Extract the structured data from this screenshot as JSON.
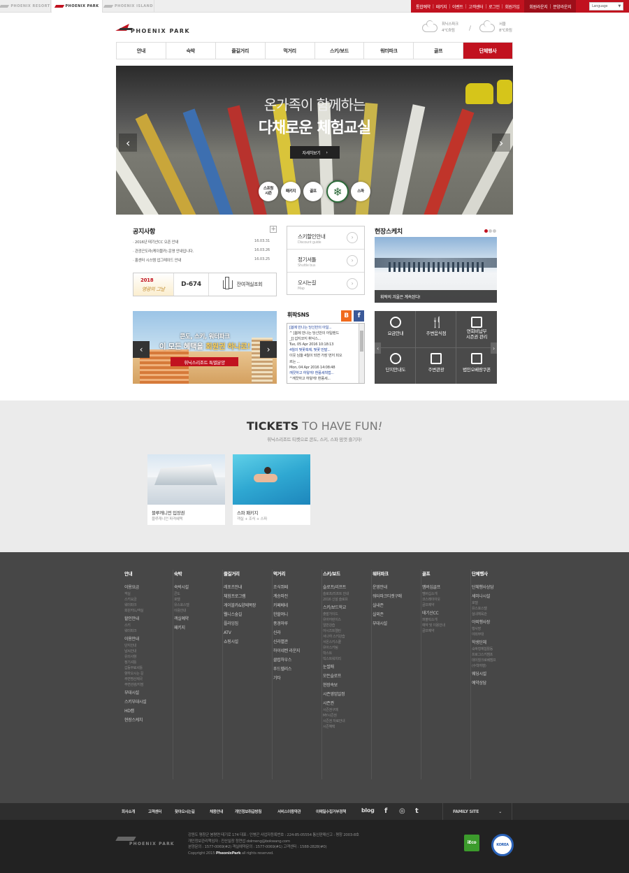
{
  "site_tabs": [
    {
      "label": "PHOENIX RESORT"
    },
    {
      "label": "PHOENIX PARK"
    },
    {
      "label": "PHOENIX ISLAND"
    }
  ],
  "util_links": [
    "통합예약",
    "패키지",
    "이벤트",
    "고객센터",
    "로그인",
    "회원가입"
  ],
  "util_links_dark": [
    "회원라운지",
    "분양라운지"
  ],
  "language": {
    "label": "Language",
    "options_hint": "▼"
  },
  "logo": {
    "text": "PHOENIX PARK"
  },
  "weather": [
    {
      "place": "휘닉스파크",
      "temp": "4℃흐림"
    },
    {
      "place": "서울",
      "temp": "8℃흐림"
    }
  ],
  "weather_sep": "/",
  "gnb": [
    "안내",
    "숙박",
    "즐길거리",
    "먹거리",
    "스키/보드",
    "워터파크",
    "골프",
    "단체행사"
  ],
  "hero": {
    "line1": "온가족이 함께하는",
    "line2": "다채로운 체험교실",
    "button": "자세히보기",
    "button_arrow": "›",
    "prev": "‹",
    "next": "›",
    "circles": [
      "스프링\n시즌",
      "패키지",
      "골프",
      "",
      "스파"
    ],
    "colors": {
      "red": "#c1121f"
    }
  },
  "notice": {
    "title": "공지사항",
    "plus": "+",
    "items": [
      {
        "text": "· 2016년 태기산CC 오픈 안내",
        "date": "16.03.31"
      },
      {
        "text": "· 관광곤도라(케이블카) 운영 안내입니다.",
        "date": "16.03.26"
      },
      {
        "text": "· 홀센터 시스템 업그레이드 안내",
        "date": "16.03.25"
      }
    ]
  },
  "dday": {
    "year": "2018",
    "name": "영광의 그날",
    "count": "D-674",
    "rooms": "잔여객실조회"
  },
  "quick": [
    {
      "title": "스키할인안내",
      "sub": "Discount guide"
    },
    {
      "title": "정기셔틀",
      "sub": "Shuttle bus"
    },
    {
      "title": "오시는길",
      "sub": "Map"
    }
  ],
  "quick_arrow": "›",
  "sketch": {
    "title": "현장스케치",
    "caption": "휘팍의 겨울은 계속된다!"
  },
  "banner": {
    "line1": "콘도, 스키, 워터파크",
    "line2a": "이 모든 혜택을 ",
    "line2b": "회원권 하나로!",
    "tag": "휘닉스리조트 특별분양",
    "prev": "‹",
    "next": "›"
  },
  "sns": {
    "title": "휘팍SNS",
    "blog": "B",
    "facebook": "f",
    "lines": [
      {
        "t": "[봄에 만나는 당신만의 아일...",
        "blue": true
      },
      {
        "t": "^ [봄에 만나는 당신만의 아일랜드",
        "blue": false
      },
      {
        "t": "_]] 섭지코지 휘닉스...",
        "blue": false
      },
      {
        "t": "Tue, 05 Apr 2016 10:18:13",
        "blue": false
      },
      {
        "t": "4월의 벚꽃축제, 벚꽃 만발...",
        "blue": true
      },
      {
        "t": "이웃 님들 4월이 되면 가장 먼저 피오",
        "blue": false
      },
      {
        "t": "르는 ...",
        "blue": false
      },
      {
        "t": "Mon, 04 Apr 2016 14:08:48",
        "blue": false
      },
      {
        "t": "깨끗하고 하얗게! 환풍세척법...",
        "blue": true
      },
      {
        "t": "^깨끗하고 하얗게! 환풍세...",
        "blue": false
      }
    ]
  },
  "dgrid": {
    "items": [
      {
        "label": "요금안내"
      },
      {
        "label": "주변음식점"
      },
      {
        "label": "연회비납부\n시즌권 관리"
      },
      {
        "label": "단지안내도"
      },
      {
        "label": "주변관광"
      },
      {
        "label": "법인오베랑쿠폰"
      }
    ],
    "prev": "‹",
    "next": "›"
  },
  "tickets": {
    "title_bold": "TICKETS",
    "title_rest": " TO HAVE FUN",
    "bang": "!",
    "sub": "휘닉스리조트 티켓으로 콘도, 스키, 스파 맘껏 즐기자!",
    "cards": [
      {
        "title": "블루캐니언 입장권",
        "sub": "블루캐니언 파격혜택"
      },
      {
        "title": "스파 패키지",
        "sub": "객실 + 조식 + 스파"
      }
    ]
  },
  "sitemap": [
    {
      "h": "안내",
      "items": [
        {
          "t": "이용요금",
          "subs": [
            "객실",
            "스키요금",
            "워터파크",
            "회원카드/객실"
          ]
        },
        {
          "t": "할인안내",
          "subs": [
            "스키",
            "워터파크"
          ]
        },
        {
          "t": "이용안내",
          "subs": [
            "단지안내",
            "날씨안내",
            "유의사항",
            "정기셔틀",
            "갑동무료셔틀",
            "항하오시는 길",
            "주변명산제국",
            "주변관광/지점"
          ]
        },
        {
          "t": "부대시설",
          "subs": []
        },
        {
          "t": "스키부대시설",
          "subs": []
        },
        {
          "t": "HD캠",
          "subs": []
        },
        {
          "t": "현장스케치",
          "subs": []
        }
      ]
    },
    {
      "h": "숙박",
      "items": [
        {
          "t": "숙박시설",
          "subs": [
            "콘도",
            "호텔",
            "유스호스텔",
            "이용안내"
          ]
        },
        {
          "t": "객실예약",
          "subs": []
        },
        {
          "t": "패키지",
          "subs": []
        }
      ]
    },
    {
      "h": "즐길거리",
      "items": [
        {
          "t": "레포츠안내",
          "subs": []
        },
        {
          "t": "체험프로그램",
          "subs": []
        },
        {
          "t": "게이블카&양떼목장",
          "subs": []
        },
        {
          "t": "웰니스숲길",
          "subs": []
        },
        {
          "t": "플라잉짐",
          "subs": []
        },
        {
          "t": "ATV",
          "subs": []
        },
        {
          "t": "쇼핑시설",
          "subs": []
        }
      ]
    },
    {
      "h": "먹거리",
      "items": [
        {
          "t": "조식뷔페",
          "subs": []
        },
        {
          "t": "계승파전",
          "subs": []
        },
        {
          "t": "카페베네",
          "subs": []
        },
        {
          "t": "한할머니",
          "subs": []
        },
        {
          "t": "풍경마루",
          "subs": []
        },
        {
          "t": "신라",
          "subs": []
        },
        {
          "t": "신라별관",
          "subs": []
        },
        {
          "t": "하이네켄 라운지",
          "subs": []
        },
        {
          "t": "클럽하우스",
          "subs": []
        },
        {
          "t": "푸드헬리스",
          "subs": []
        },
        {
          "t": "기타",
          "subs": []
        }
      ]
    },
    {
      "h": "스키/보드",
      "items": [
        {
          "t": "슬로프/리프트",
          "subs": [
            "슬로프/리프트 안내",
            "2016 신설 슬로프"
          ]
        },
        {
          "t": "스키/보드학교",
          "subs": [
            "출발가이드",
            "유아어린이스",
            "일반강습",
            "어시즈트렐린",
            "서나하 스키강습",
            "서온스키스쿨",
            "유아스키팀",
            "학스트",
            "빅스트워치리"
          ]
        },
        {
          "t": "눈썰매",
          "subs": []
        },
        {
          "t": "모든슬로프",
          "subs": []
        },
        {
          "t": "현장속보",
          "subs": []
        },
        {
          "t": "시즌영업일정",
          "subs": []
        },
        {
          "t": "시즌권",
          "subs": [
            "시즌권구매",
            "MY시즌권",
            "시즌권 자료안내",
            "시즌혜택"
          ]
        }
      ]
    },
    {
      "h": "워터파크",
      "items": [
        {
          "t": "운영안내",
          "subs": []
        },
        {
          "t": "워터파크티켓구매",
          "subs": []
        },
        {
          "t": "실내존",
          "subs": []
        },
        {
          "t": "실외존",
          "subs": []
        },
        {
          "t": "부대시설",
          "subs": []
        }
      ]
    },
    {
      "h": "골프",
      "items": [
        {
          "t": "멤버십골프",
          "subs": [
            "멤버십소개",
            "코스레이아웃",
            "골프예약"
          ]
        },
        {
          "t": "태기산CC",
          "subs": [
            "퍼블릭소개",
            "예약 및 이용안내",
            "골프예약"
          ]
        }
      ]
    },
    {
      "h": "단체행사",
      "items": [
        {
          "t": "단체행사상담",
          "subs": []
        },
        {
          "t": "세미나시설",
          "subs": [
            "호텔",
            "유스호스텔",
            "실내체육관"
          ]
        },
        {
          "t": "야외행사장",
          "subs": [
            "행사장",
            "야외무대"
          ]
        },
        {
          "t": "학생단체",
          "subs": [
            "숙박형체험활동",
            "프로그스키캠프",
            "데이힐크로베캠프",
            "(수학여행)"
          ]
        },
        {
          "t": "웨딩시설",
          "subs": []
        },
        {
          "t": "예약상담",
          "subs": []
        }
      ]
    }
  ],
  "footer_links": [
    "회사소개",
    "고객센터",
    "찾아오시는길",
    "채용안내",
    "개인정보취급방침",
    "서비스이용약관",
    "이메일수집거부정책"
  ],
  "footer_blog": "blog",
  "footer_social": {
    "facebook": "f",
    "instagram": "◎",
    "twitter": "t"
  },
  "family_site": {
    "label": "FAMILY SITE",
    "arrow": "⌄"
  },
  "bottom": {
    "logo": "PHOENIX PARK",
    "l1": "강원도 평창군 봉평면 태기로 174 대표 : 인병곤 사업자등록번호 : 224-85-05554 통신판매신고 : 평창 2003-8호",
    "l2": "개인정보관리책임자 : 진산실장 정연섭 dolmeng@bokwang.com",
    "l3": "분양문의 : 1577-0069(#2) 객실예약문의 : 1577-0069(#1) 고객센터 : 1588-2828(#0)",
    "copy_pre": "Copyright 2015 ",
    "copy_brand": "PheonixPark",
    "copy_post": " all rights reserved.",
    "eco": "iEco",
    "badge": "KOREA"
  }
}
